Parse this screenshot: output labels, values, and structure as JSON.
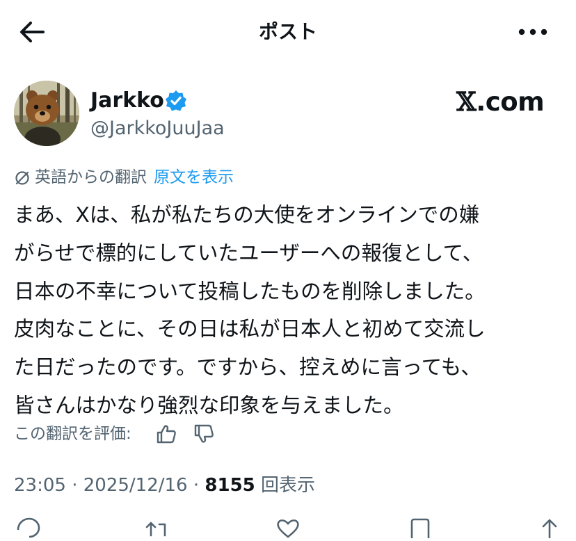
{
  "header": {
    "title": "ポスト"
  },
  "author": {
    "display_name": "Jarkko",
    "handle": "@JarkkoJuuJaa",
    "verified": true,
    "badge_color": "#1d9bf0"
  },
  "watermark": {
    "x_glyph": "𝕏",
    "domain": ".com"
  },
  "translation": {
    "source_label": "英語からの翻訳",
    "show_original_label": "原文を表示"
  },
  "post": {
    "lines": [
      "まあ、Xは、私が私たちの大使をオンラインでの嫌",
      "がらせで標的にしていたユーザーへの報復として、",
      "日本の不幸について投稿したものを削除しました。",
      "皮肉なことに、その日は私が日本人と初めて交流し",
      "た日だったのです。ですから、控えめに言っても、",
      "皆さんはかなり強烈な印象を与えました。"
    ]
  },
  "rating": {
    "label": "この翻訳を評価:"
  },
  "meta": {
    "time": "23:05",
    "separator": "·",
    "date": "2025/12/16",
    "views_count": "8155",
    "views_label": "回表示"
  },
  "colors": {
    "text": "#0f1419",
    "secondary": "#536471",
    "link": "#1d9bf0"
  }
}
